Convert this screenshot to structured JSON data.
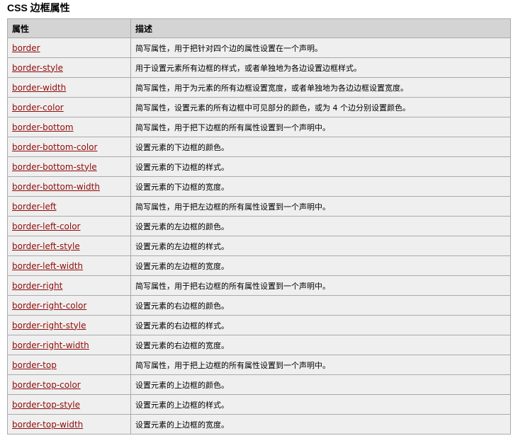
{
  "title": "CSS 边框属性",
  "table": {
    "headers": [
      "属性",
      "描述"
    ],
    "rows": [
      {
        "property": "border",
        "description": "简写属性，用于把针对四个边的属性设置在一个声明。"
      },
      {
        "property": "border-style",
        "description": "用于设置元素所有边框的样式，或者单独地为各边设置边框样式。"
      },
      {
        "property": "border-width",
        "description": "简写属性，用于为元素的所有边框设置宽度，或者单独地为各边边框设置宽度。"
      },
      {
        "property": "border-color",
        "description": "简写属性，设置元素的所有边框中可见部分的颜色，或为 4 个边分别设置颜色。"
      },
      {
        "property": "border-bottom",
        "description": "简写属性，用于把下边框的所有属性设置到一个声明中。"
      },
      {
        "property": "border-bottom-color",
        "description": "设置元素的下边框的颜色。"
      },
      {
        "property": "border-bottom-style",
        "description": "设置元素的下边框的样式。"
      },
      {
        "property": "border-bottom-width",
        "description": "设置元素的下边框的宽度。"
      },
      {
        "property": "border-left",
        "description": "简写属性，用于把左边框的所有属性设置到一个声明中。"
      },
      {
        "property": "border-left-color",
        "description": "设置元素的左边框的颜色。"
      },
      {
        "property": "border-left-style",
        "description": "设置元素的左边框的样式。"
      },
      {
        "property": "border-left-width",
        "description": "设置元素的左边框的宽度。"
      },
      {
        "property": "border-right",
        "description": "简写属性，用于把右边框的所有属性设置到一个声明中。"
      },
      {
        "property": "border-right-color",
        "description": "设置元素的右边框的颜色。"
      },
      {
        "property": "border-right-style",
        "description": "设置元素的右边框的样式。"
      },
      {
        "property": "border-right-width",
        "description": "设置元素的右边框的宽度。"
      },
      {
        "property": "border-top",
        "description": "简写属性，用于把上边框的所有属性设置到一个声明中。"
      },
      {
        "property": "border-top-color",
        "description": "设置元素的上边框的颜色。"
      },
      {
        "property": "border-top-style",
        "description": "设置元素的上边框的样式。"
      },
      {
        "property": "border-top-width",
        "description": "设置元素的上边框的宽度。"
      }
    ]
  },
  "colors": {
    "link": "#900b09",
    "header_bg": "#d4d4d4",
    "row_bg": "#efefef",
    "border": "#aaaaaa"
  }
}
